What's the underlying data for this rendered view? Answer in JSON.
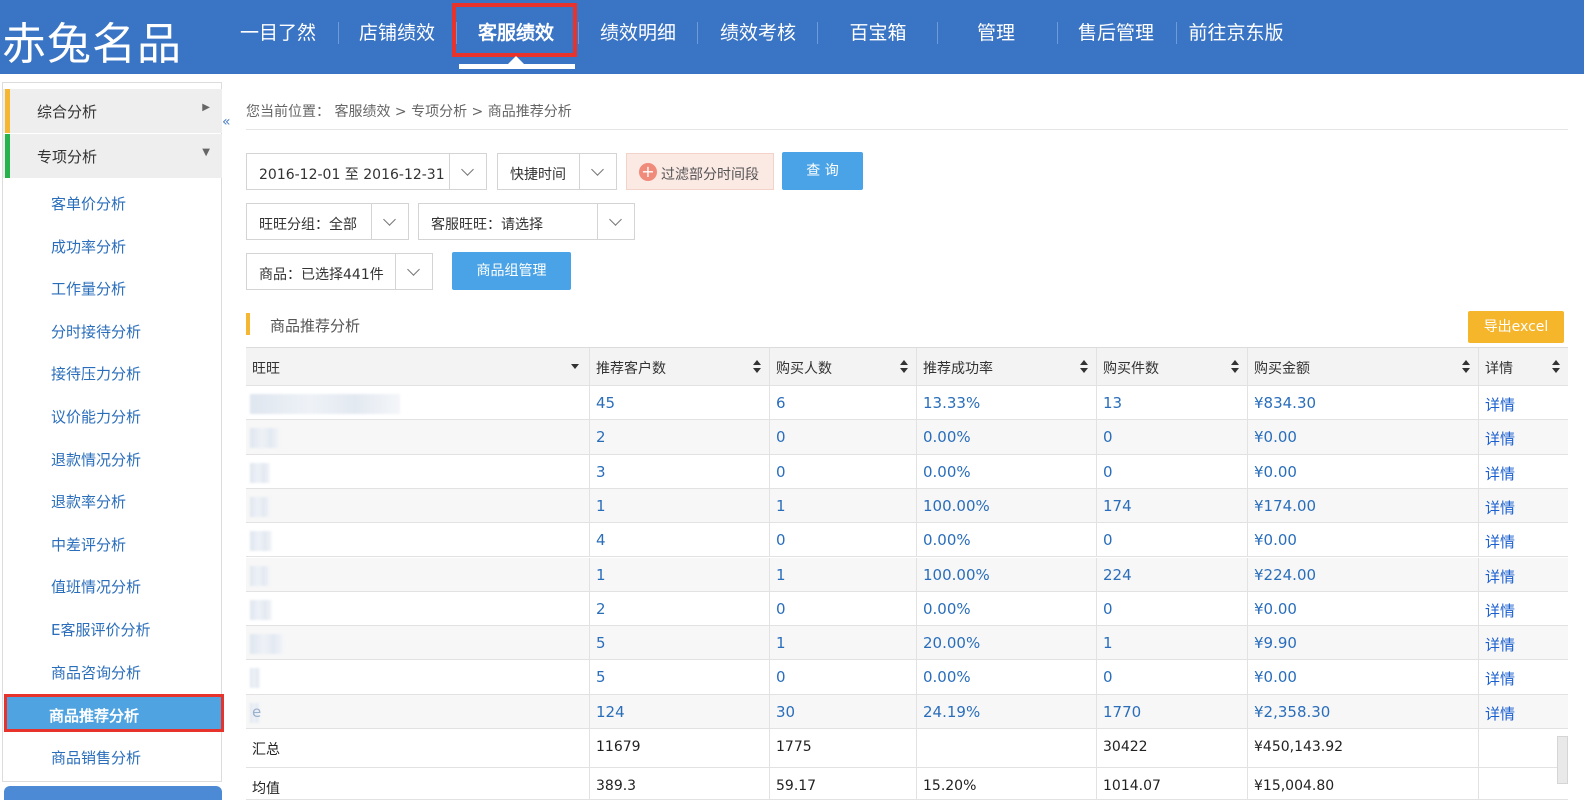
{
  "header": {
    "logo": "赤兔名品",
    "nav": [
      "一目了然",
      "店铺绩效",
      "客服绩效",
      "绩效明细",
      "绩效考核",
      "百宝箱",
      "管理",
      "售后管理",
      "前往京东版"
    ],
    "active_nav": "客服绩效"
  },
  "sidebar": {
    "sections": [
      {
        "label": "综合分析",
        "accent": "#f5b731"
      },
      {
        "label": "专项分析",
        "accent": "#27b34b"
      }
    ],
    "items": [
      "客单价分析",
      "成功率分析",
      "工作量分析",
      "分时接待分析",
      "接待压力分析",
      "议价能力分析",
      "退款情况分析",
      "退款率分析",
      "中差评分析",
      "值班情况分析",
      "E客服评价分析",
      "商品咨询分析",
      "商品推荐分析",
      "商品销售分析"
    ],
    "active_item": "商品推荐分析"
  },
  "breadcrumb": "您当前位置： 客服绩效 > 专项分析 > 商品推荐分析",
  "filters": {
    "date_range": "2016-12-01 至 2016-12-31",
    "quick_time": "快捷时间",
    "filter_time_label": "过滤部分时间段",
    "query_label": "查 询",
    "wangwang_group": "旺旺分组：全部",
    "service_wangwang": "客服旺旺：请选择",
    "product": "商品：已选择441件",
    "product_group_label": "商品组管理"
  },
  "section": {
    "title": "商品推荐分析",
    "export_label": "导出excel"
  },
  "table": {
    "headers": [
      "旺旺",
      "推荐客户数",
      "购买人数",
      "推荐成功率",
      "购买件数",
      "购买金额",
      "详情"
    ],
    "rows": [
      [
        "",
        "45",
        "6",
        "13.33%",
        "13",
        "¥834.30",
        "详情"
      ],
      [
        "",
        "2",
        "0",
        "0.00%",
        "0",
        "¥0.00",
        "详情"
      ],
      [
        "",
        "3",
        "0",
        "0.00%",
        "0",
        "¥0.00",
        "详情"
      ],
      [
        "",
        "1",
        "1",
        "100.00%",
        "174",
        "¥174.00",
        "详情"
      ],
      [
        "",
        "4",
        "0",
        "0.00%",
        "0",
        "¥0.00",
        "详情"
      ],
      [
        "",
        "1",
        "1",
        "100.00%",
        "224",
        "¥224.00",
        "详情"
      ],
      [
        "",
        "2",
        "0",
        "0.00%",
        "0",
        "¥0.00",
        "详情"
      ],
      [
        "",
        "5",
        "1",
        "20.00%",
        "1",
        "¥9.90",
        "详情"
      ],
      [
        "",
        "5",
        "0",
        "0.00%",
        "0",
        "¥0.00",
        "详情"
      ],
      [
        "e",
        "124",
        "30",
        "24.19%",
        "1770",
        "¥2,358.30",
        "详情"
      ]
    ],
    "summary": [
      "汇总",
      "11679",
      "1775",
      "",
      "30422",
      "¥450,143.92",
      ""
    ],
    "average": [
      "均值",
      "389.3",
      "59.17",
      "15.20%",
      "1014.07",
      "¥15,004.80",
      ""
    ]
  }
}
